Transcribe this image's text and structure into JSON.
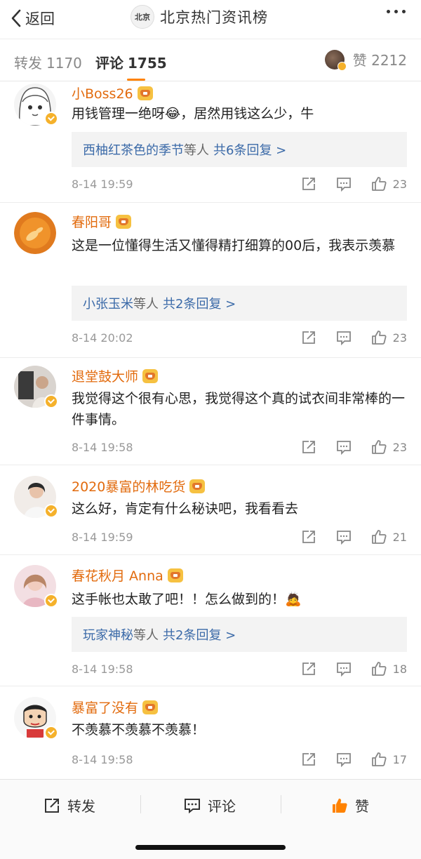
{
  "nav": {
    "back_label": "返回",
    "title": "北京热门资讯榜",
    "logo_text": "北京"
  },
  "tabs": {
    "repost_label": "转发",
    "repost_count": "1170",
    "comment_label": "评论",
    "comment_count": "1755",
    "like_label": "赞",
    "like_count": "2212"
  },
  "comments": [
    {
      "username": "小Boss26",
      "text": "用钱管理一绝呀😂，居然用钱这么少，牛",
      "reply_users": "西柚红茶色的季节",
      "reply_suffix": "等人",
      "reply_count": "共6条回复 >",
      "time": "8-14 19:59",
      "likes": "23"
    },
    {
      "username": "春阳哥",
      "text": "这是一位懂得生活又懂得精打细算的00后，我表示羡慕",
      "reply_users": "小张玉米",
      "reply_suffix": "等人",
      "reply_count": "共2条回复 >",
      "time": "8-14 20:02",
      "likes": "23"
    },
    {
      "username": "退堂鼓大师",
      "text": "我觉得这个很有心思，我觉得这个真的试衣间非常棒的一件事情。",
      "time": "8-14 19:58",
      "likes": "23"
    },
    {
      "username": "2020暴富的林吃货",
      "text": "这么好，肯定有什么秘诀吧，我看看去",
      "time": "8-14 19:59",
      "likes": "21"
    },
    {
      "username": "春花秋月 Anna",
      "text": "这手帐也太敢了吧！！怎么做到的！🙇",
      "reply_users": "玩家神秘",
      "reply_suffix": "等人",
      "reply_count": "共2条回复 >",
      "time": "8-14 19:58",
      "likes": "18"
    },
    {
      "username": "暴富了没有",
      "text": "不羡慕不羡慕不羡慕！",
      "time": "8-14 19:58",
      "likes": "17"
    }
  ],
  "bottombar": {
    "repost_label": "转发",
    "comment_label": "评论",
    "like_label": "赞"
  },
  "colors": {
    "accent": "#ff8200",
    "username": "#e26b0e",
    "link": "#3b6aa8"
  }
}
